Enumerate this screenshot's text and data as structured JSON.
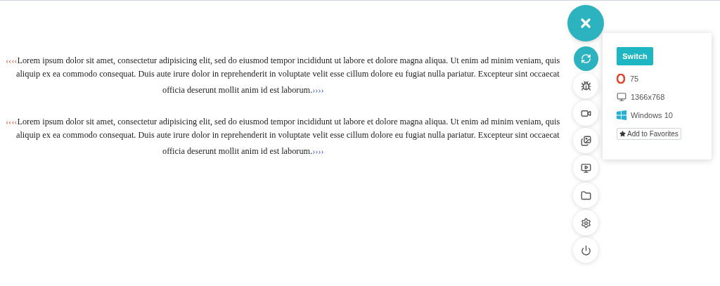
{
  "paragraphs": [
    {
      "open_mark": "‹‹‹‹",
      "lines": [
        "Lorem ipsum dolor sit amet, consectetur adipisicing elit, sed do eiusmod tempor incididunt ut labore et dolore magna aliqua. Ut enim ad minim veniam, quis",
        "aliquip ex ea commodo consequat. Duis aute irure dolor in reprehenderit in voluptate velit esse cillum dolore eu fugiat nulla pariatur. Excepteur sint occaecat",
        "officia deserunt mollit anim id est laborum."
      ],
      "close_mark": "››››"
    },
    {
      "open_mark": "‹‹‹‹",
      "lines": [
        "Lorem ipsum dolor sit amet, consectetur adipisicing elit, sed do eiusmod tempor incididunt ut labore et dolore magna aliqua. Ut enim ad minim veniam, quis",
        "aliquip ex ea commodo consequat. Duis aute irure dolor in reprehenderit in voluptate velit esse cillum dolore eu fugiat nulla pariatur. Excepteur sint occaecat",
        "officia deserunt mollit anim id est laborum."
      ],
      "close_mark": "››››"
    }
  ],
  "tools": [
    {
      "kind": "switch",
      "selected": true
    },
    {
      "kind": "bug",
      "selected": false
    },
    {
      "kind": "video",
      "selected": false
    },
    {
      "kind": "gallery",
      "selected": false
    },
    {
      "kind": "remote",
      "selected": false
    },
    {
      "kind": "folder",
      "selected": false
    },
    {
      "kind": "settings",
      "selected": false
    },
    {
      "kind": "power",
      "selected": false
    }
  ],
  "popup": {
    "button": "Switch",
    "browser_version": "75",
    "resolution": "1366x768",
    "os": "Windows 10",
    "favorite_button": "Add to Favorites"
  }
}
